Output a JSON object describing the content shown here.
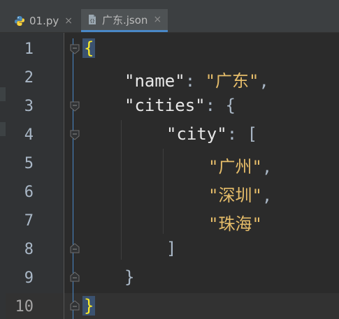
{
  "tabs": [
    {
      "label": "01.py",
      "icon": "python-file-icon",
      "close": "×"
    },
    {
      "label": "广东.json",
      "icon": "json-file-icon",
      "close": "×"
    }
  ],
  "line_numbers": [
    "1",
    "2",
    "3",
    "4",
    "5",
    "6",
    "7",
    "8",
    "9",
    "10"
  ],
  "code": {
    "l1_open": "{",
    "l2_key": "\"name\"",
    "l2_colon": ": ",
    "l2_value": "\"广东\"",
    "l2_comma": ",",
    "l3_key": "\"cities\"",
    "l3_rest": ": {",
    "l4_key": "\"city\"",
    "l4_rest": ": [",
    "l5_value": "\"广州\"",
    "l5_comma": ",",
    "l6_value": "\"深圳\"",
    "l6_comma": ",",
    "l7_value": "\"珠海\"",
    "l8_close": "]",
    "l9_close": "}",
    "l10_close": "}"
  },
  "colors": {
    "background": "#2b2b2b",
    "string": "#e6bd6a",
    "key": "#e8e8e8",
    "brace_highlight": "#ffef28",
    "accent": "#4a88c7"
  }
}
